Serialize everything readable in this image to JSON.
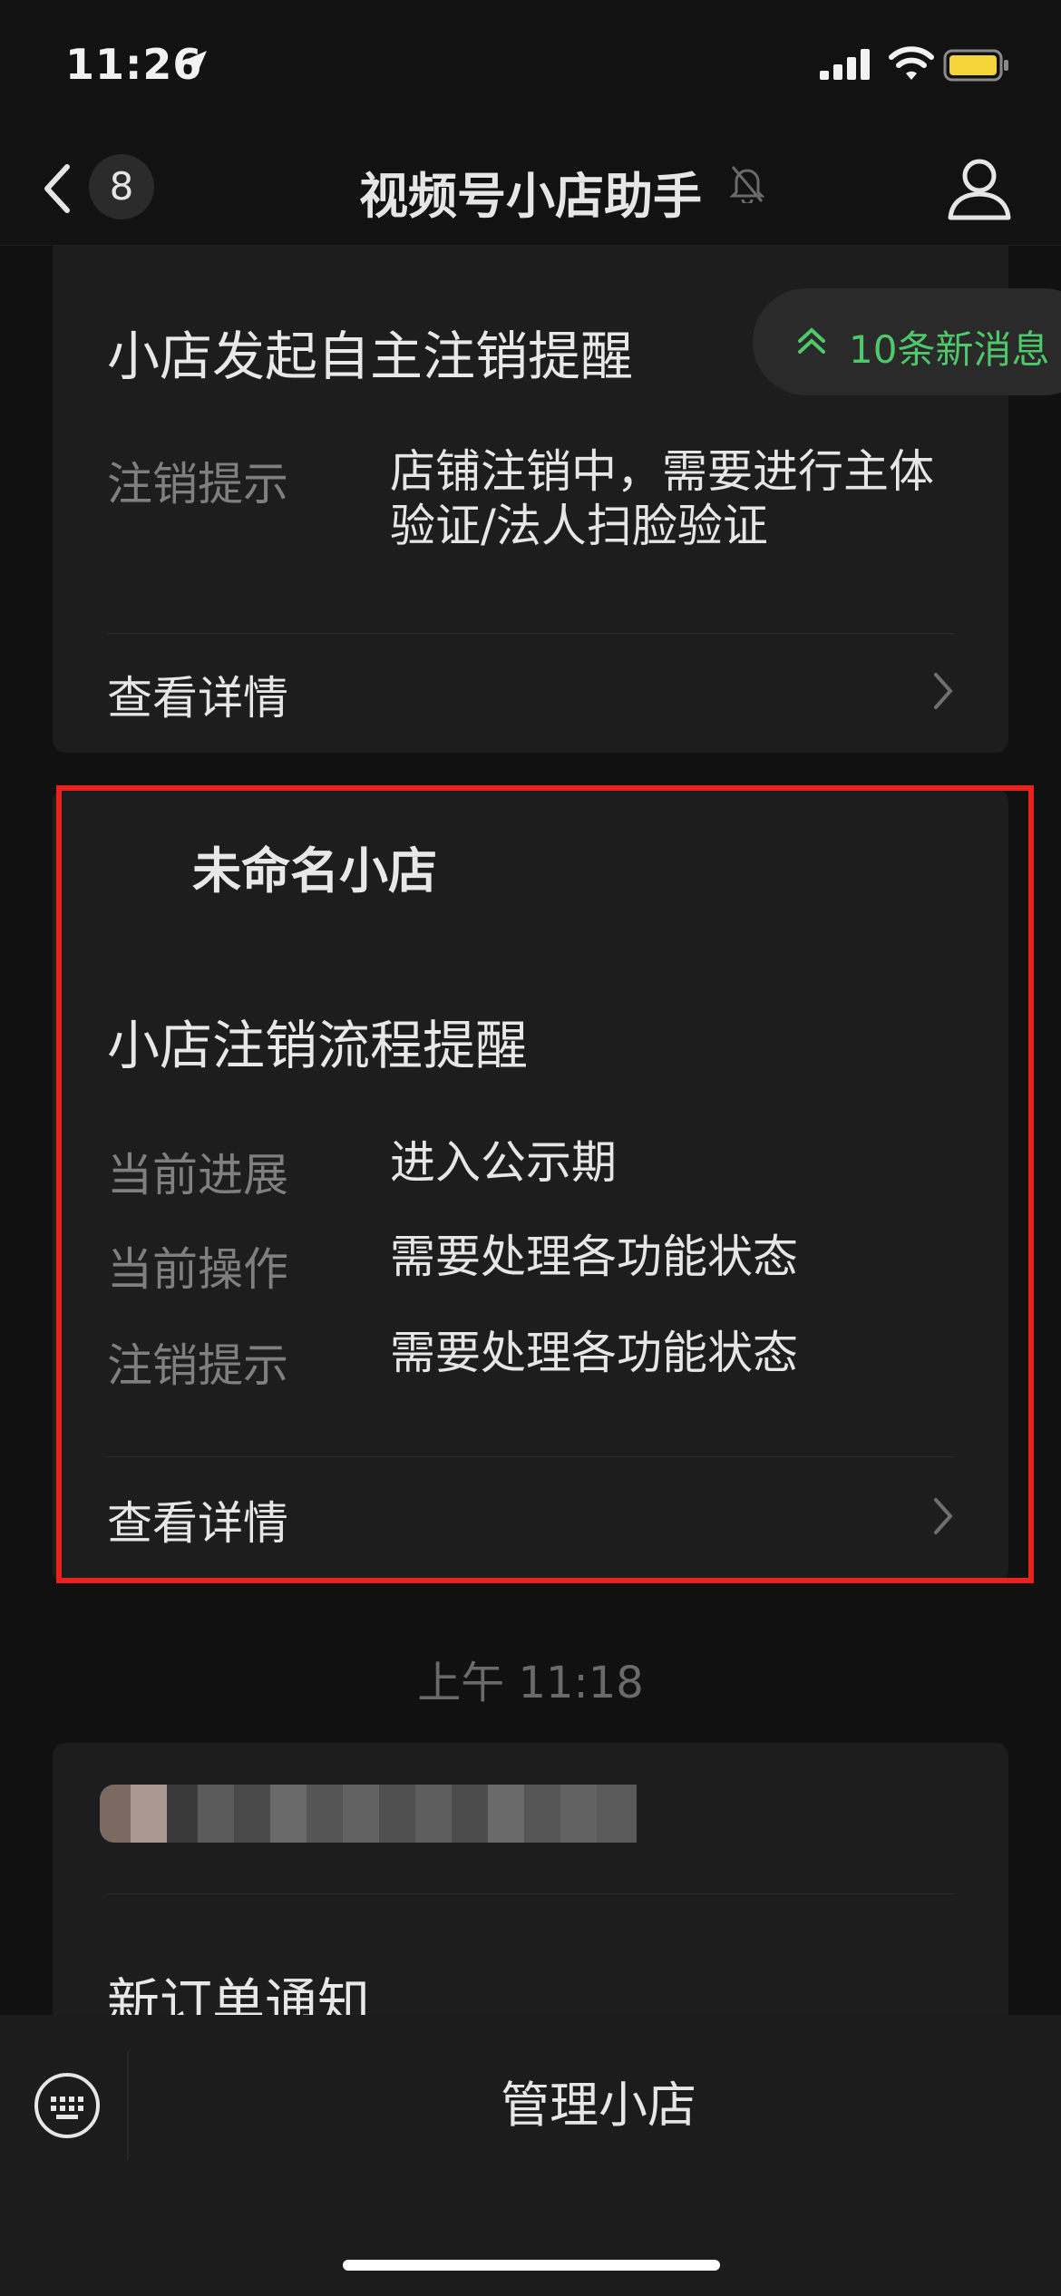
{
  "status_bar": {
    "time": "11:26"
  },
  "nav": {
    "unread_count": "8",
    "title": "视频号小店助手"
  },
  "new_messages": {
    "label": "10条新消息"
  },
  "card1": {
    "title": "小店发起自主注销提醒",
    "rows": [
      {
        "label": "注销提示",
        "value": "店铺注销中，需要进行主体验证/法人扫脸验证"
      }
    ],
    "detail_link": "查看详情"
  },
  "card2": {
    "shop_name": "未命名小店",
    "title": "小店注销流程提醒",
    "rows": [
      {
        "label": "当前进展",
        "value": "进入公示期"
      },
      {
        "label": "当前操作",
        "value": "需要处理各功能状态"
      },
      {
        "label": "注销提示",
        "value": "需要处理各功能状态"
      }
    ],
    "detail_link": "查看详情"
  },
  "timestamp": "上午 11:18",
  "card3": {
    "title": "新订单通知"
  },
  "bottom": {
    "manage_button": "管理小店"
  },
  "colors": {
    "highlight": "#e8231d",
    "accent_green": "#4fc76b",
    "background": "#111111",
    "card": "#1d1d1d"
  },
  "icons": [
    "location-arrow-icon",
    "signal-icon",
    "wifi-icon",
    "battery-icon",
    "back-chevron-icon",
    "mute-bell-icon",
    "profile-icon",
    "double-chevron-up-icon",
    "chevron-right-icon",
    "keyboard-icon"
  ]
}
